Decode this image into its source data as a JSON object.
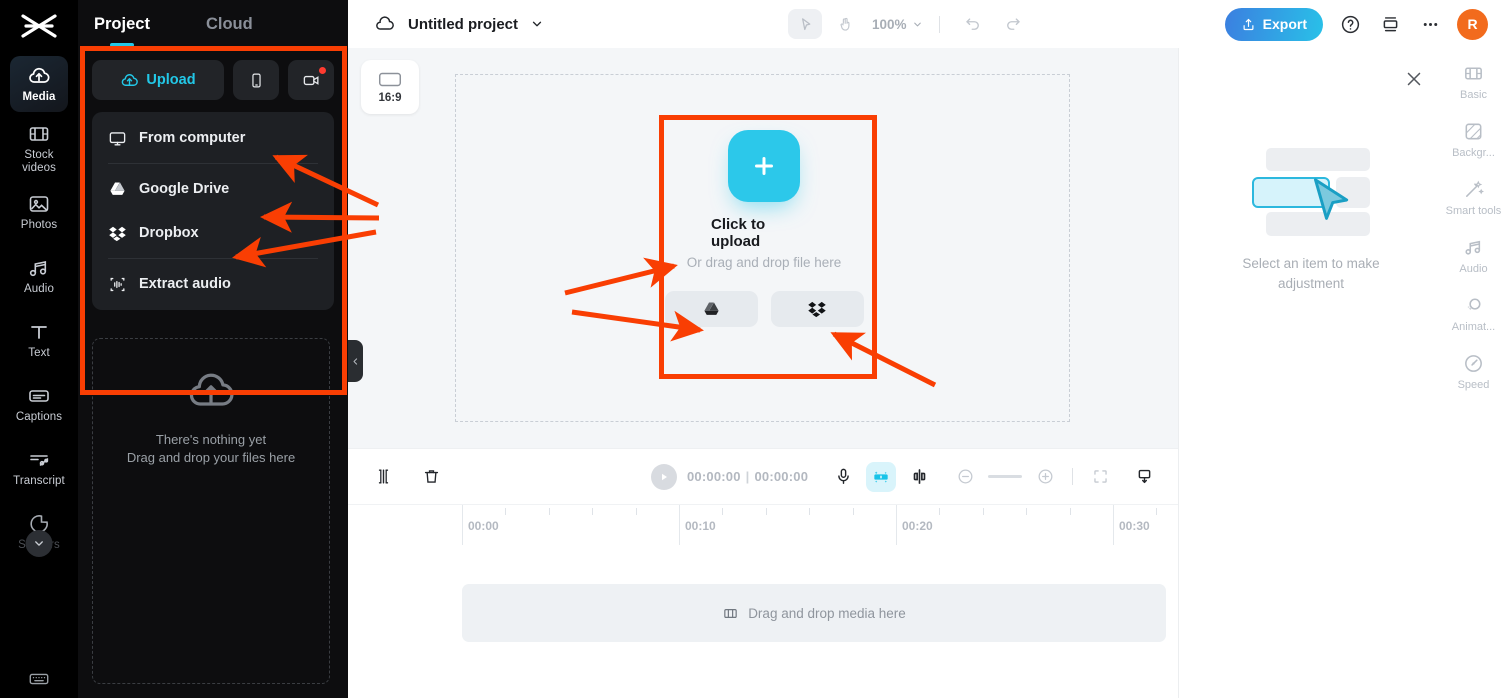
{
  "rail": {
    "logo": "capcut-logo-icon",
    "items": [
      {
        "label": "Media",
        "icon": "cloud-upload-icon",
        "active": true
      },
      {
        "label": "Stock videos",
        "icon": "film-strip-icon",
        "active": false
      },
      {
        "label": "Photos",
        "icon": "photo-icon",
        "active": false
      },
      {
        "label": "Audio",
        "icon": "music-notes-icon",
        "active": false
      },
      {
        "label": "Text",
        "icon": "text-t-icon",
        "active": false
      },
      {
        "label": "Captions",
        "icon": "captions-icon",
        "active": false
      },
      {
        "label": "Transcript",
        "icon": "transcript-icon",
        "active": false
      },
      {
        "label": "Stickers",
        "icon": "sticker-icon",
        "active": false,
        "dimmed": true
      }
    ],
    "bottom_icon": "keyboard-icon"
  },
  "panel": {
    "tabs": [
      {
        "label": "Project",
        "active": true
      },
      {
        "label": "Cloud",
        "active": false
      }
    ],
    "sources": {
      "upload_label": "Upload",
      "upload_icon": "cloud-upload-icon",
      "phone_icon": "phone-icon",
      "record_icon": "camera-record-icon"
    },
    "menu": [
      {
        "label": "From computer",
        "icon": "monitor-icon"
      },
      {
        "label": "Google Drive",
        "icon": "google-drive-icon"
      },
      {
        "label": "Dropbox",
        "icon": "dropbox-icon"
      },
      {
        "label": "Extract audio",
        "icon": "extract-audio-icon"
      }
    ],
    "empty": {
      "icon": "cloud-upload-icon",
      "line1": "There's nothing yet",
      "line2": "Drag and drop your files here"
    },
    "collapse_icon": "chevron-left-icon"
  },
  "topbar": {
    "cloud_icon": "cloud-icon",
    "project_name": "Untitled project",
    "project_chevron": "chevron-down-icon",
    "select_tool_icon": "cursor-arrow-icon",
    "hand_tool_icon": "hand-icon",
    "zoom_level": "100%",
    "zoom_chevron": "chevron-down-icon",
    "undo_icon": "undo-icon",
    "redo_icon": "redo-icon",
    "export_label": "Export",
    "export_icon": "share-export-icon",
    "help_icon": "question-circle-icon",
    "layers_icon": "stack-icon",
    "more_icon": "more-horizontal-icon",
    "avatar_initial": "R",
    "accent_color": "#29c1e8",
    "avatar_color": "#f26b1d"
  },
  "canvas": {
    "ratio_label": "16:9",
    "ratio_icon": "aspect-ratio-icon",
    "upload": {
      "plus_icon": "plus-icon",
      "title": "Click to upload",
      "subtitle": "Or drag and drop file here",
      "google_drive_icon": "google-drive-icon",
      "dropbox_icon": "dropbox-icon"
    }
  },
  "inspector": {
    "close_icon": "close-icon",
    "empty_line1": "Select an item to make",
    "empty_line2": "adjustment",
    "rail": [
      {
        "label": "Basic",
        "icon": "film-strip-icon"
      },
      {
        "label": "Backgr...",
        "icon": "background-icon"
      },
      {
        "label": "Smart tools",
        "icon": "magic-wand-icon"
      },
      {
        "label": "Audio",
        "icon": "music-notes-icon"
      },
      {
        "label": "Animat...",
        "icon": "animation-icon"
      },
      {
        "label": "Speed",
        "icon": "speedometer-icon"
      }
    ]
  },
  "timeline": {
    "split_icon": "split-icon",
    "delete_icon": "trash-icon",
    "play_icon": "play-icon",
    "current_time": "00:00:00",
    "total_time": "00:00:00",
    "time_separator": "|",
    "mic_icon": "microphone-icon",
    "ai_icon": "ai-enhance-icon",
    "cut_icon": "cut-clip-icon",
    "zoom_out_icon": "minus-circle-icon",
    "zoom_in_icon": "plus-circle-icon",
    "fit_icon": "fit-screen-icon",
    "marker_icon": "marker-icon",
    "ruler_labels": [
      "00:00",
      "00:10",
      "00:20",
      "00:30"
    ],
    "empty_track_label": "Drag and drop media here",
    "empty_track_icon": "film-strip-icon"
  },
  "annotations": {
    "highlight_color": "#f93e03"
  }
}
